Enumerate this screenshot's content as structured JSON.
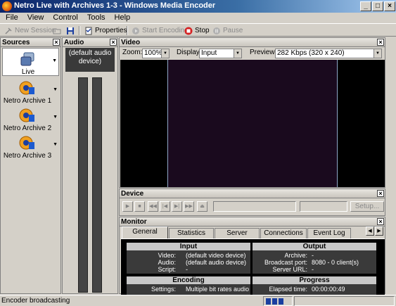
{
  "window": {
    "title": "Netro Live with Archives 1-3 - Windows Media Encoder"
  },
  "menu": [
    "File",
    "View",
    "Control",
    "Tools",
    "Help"
  ],
  "toolbar": {
    "new_session": "New Session",
    "properties": "Properties",
    "start_encoding": "Start Encoding",
    "stop": "Stop",
    "pause": "Pause"
  },
  "sources": {
    "title": "Sources",
    "items": [
      {
        "label": "Live"
      },
      {
        "label": "Netro Archive 1"
      },
      {
        "label": "Netro Archive 2"
      },
      {
        "label": "Netro Archive 3"
      }
    ]
  },
  "audio": {
    "title": "Audio",
    "device": "(default audio device)"
  },
  "video": {
    "title": "Video",
    "zoom_label": "Zoom:",
    "zoom_value": "100%",
    "display_label": "Display:",
    "display_value": "Input",
    "preview_label": "Preview:",
    "preview_value": "282 Kbps (320 x 240)"
  },
  "device": {
    "title": "Device",
    "setup_label": "Setup..."
  },
  "monitor": {
    "title": "Monitor",
    "tabs": [
      "General",
      "Statistics",
      "Server",
      "Connections",
      "Event Log"
    ],
    "active_tab": "General",
    "input": {
      "title": "Input",
      "video_label": "Video:",
      "video_value": "(default video device)",
      "audio_label": "Audio:",
      "audio_value": "(default audio device)",
      "script_label": "Script:",
      "script_value": "-"
    },
    "output": {
      "title": "Output",
      "archive_label": "Archive:",
      "archive_value": "-",
      "port_label": "Broadcast port:",
      "port_value": "8080 - 0 client(s)",
      "url_label": "Server URL:",
      "url_value": "-"
    },
    "encoding": {
      "title": "Encoding",
      "settings_label": "Settings:",
      "settings_value": "Multiple bit rates audio"
    },
    "progress": {
      "title": "Progress",
      "elapsed_label": "Elapsed time:",
      "elapsed_value": "00:00:00:49"
    }
  },
  "status": {
    "text": "Encoder broadcasting"
  },
  "colors": {
    "titlebar": "#0a246a",
    "video_bg": "#000000",
    "stop_red": "#d42020"
  }
}
